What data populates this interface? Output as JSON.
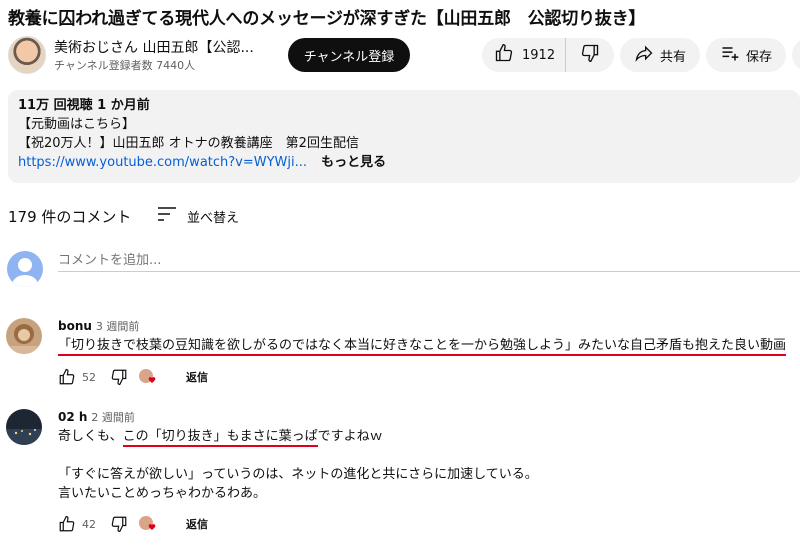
{
  "video": {
    "title": "教養に囚われ過ぎてる現代人へのメッセージが深すぎた【山田五郎　公認切り抜き】"
  },
  "channel": {
    "name": "美術おじさん 山田五郎【公認...",
    "subscribers": "チャンネル登録者数 7440人",
    "subscribe_label": "チャンネル登録"
  },
  "actions": {
    "like_count": "1912",
    "share_label": "共有",
    "save_label": "保存"
  },
  "description": {
    "meta": "11万 回視聴  1 か月前",
    "line1": "【元動画はこちら】",
    "line2": "【祝20万人！】山田五郎 オトナの教養講座　第2回生配信",
    "link": "https://www.youtube.com/watch?v=WYWji...",
    "more_label": "もっと見る"
  },
  "comments_section": {
    "count_label": "179 件のコメント",
    "sort_label": "並べ替え",
    "add_placeholder": "コメントを追加..."
  },
  "comments": [
    {
      "author": "bonu",
      "time": "3 週間前",
      "text": "「切り抜きで枝葉の豆知識を欲しがるのではなく本当に好きなことを一から勉強しよう」みたいな自己矛盾も抱えた良い動画",
      "likes": "52",
      "reply_label": "返信"
    },
    {
      "author": "02 h",
      "time": "2 週間前",
      "text_prefix": "奇しくも、",
      "text_underlined": "この「切り抜き」もまさに葉っぱ",
      "text_suffix": "ですよねｗ",
      "text_line2": "「すぐに答えが欲しい」っていうのは、ネットの進化と共にさらに加速している。",
      "text_line3": "言いたいことめっちゃわかるわあ。",
      "likes": "42",
      "reply_label": "返信"
    }
  ],
  "colors": {
    "accent_red": "#e0001b",
    "link_blue": "#065fd4",
    "pill_bg": "#f2f2f2"
  }
}
